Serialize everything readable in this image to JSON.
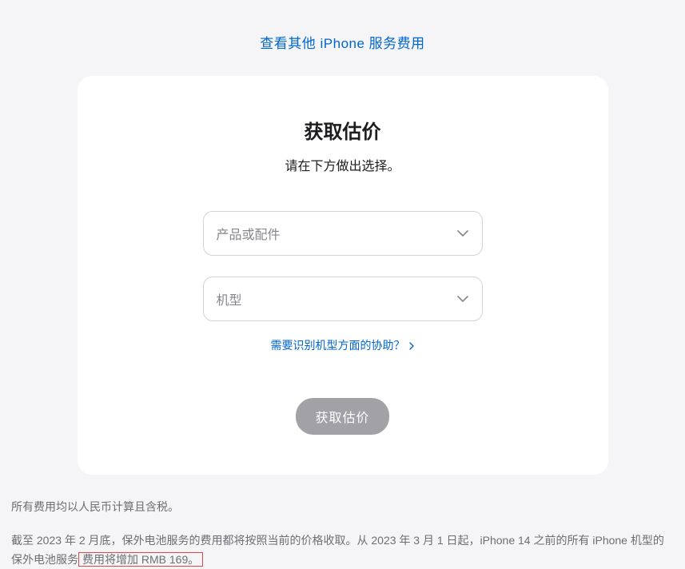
{
  "topLink": {
    "label": "查看其他 iPhone 服务费用"
  },
  "card": {
    "title": "获取估价",
    "subtitle": "请在下方做出选择。",
    "selectProductPlaceholder": "产品或配件",
    "selectModelPlaceholder": "机型",
    "helpLinkLabel": "需要识别机型方面的协助？",
    "submitLabel": "获取估价"
  },
  "footer": {
    "line1": "所有费用均以人民币计算且含税。",
    "line2_part1": "截至 2023 年 2 月底，保外电池服务的费用都将按照当前的价格收取。从 2023 年 3 月 1 日起，iPhone 14 之前的所有 iPhone 机型的保外电池服务",
    "line2_highlight": "费用将增加 RMB 169。"
  }
}
